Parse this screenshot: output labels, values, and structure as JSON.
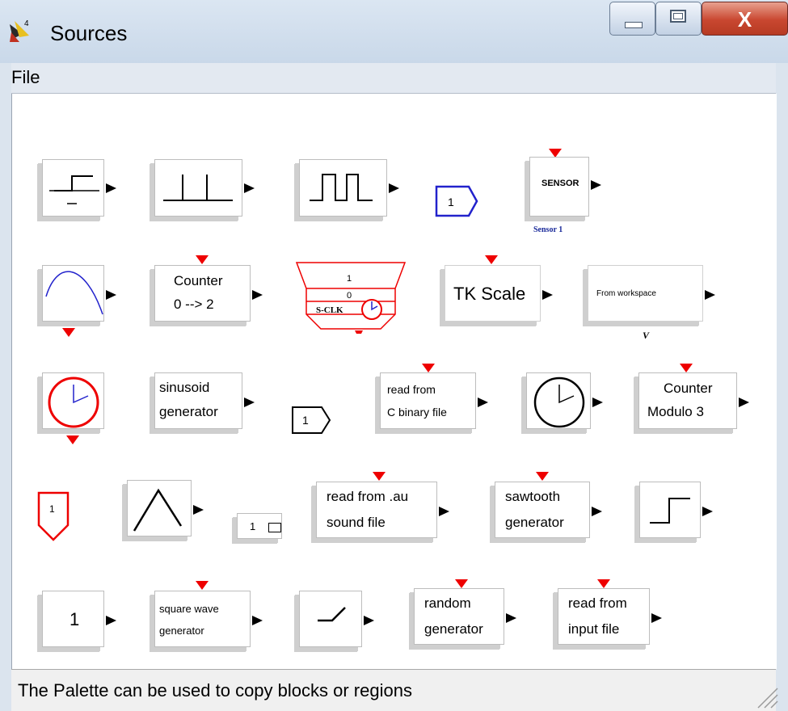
{
  "window": {
    "title": "Sources"
  },
  "menu": {
    "file": "File"
  },
  "blocks": {
    "sensor": {
      "label": "SENSOR",
      "caption": "Sensor 1"
    },
    "counter02": {
      "line1": "Counter",
      "line2": "0 --> 2"
    },
    "sclk": {
      "line1": "1",
      "line2": "0",
      "line3": "S-CLK"
    },
    "tkscale": {
      "label": "TK Scale"
    },
    "fromws": {
      "label": "From workspace",
      "caption": "V"
    },
    "sinusoid": {
      "line1": "sinusoid",
      "line2": "generator"
    },
    "readc": {
      "line1": "read from",
      "line2": "C binary file"
    },
    "countermod": {
      "line1": "Counter",
      "line2": "Modulo 3"
    },
    "readau": {
      "line1": "read from .au",
      "line2": "sound file"
    },
    "sawtooth": {
      "line1": "sawtooth",
      "line2": "generator"
    },
    "constone": {
      "label": "1"
    },
    "square": {
      "line1": "square wave",
      "line2": "generator"
    },
    "random": {
      "line1": "random",
      "line2": "generator"
    },
    "readinput": {
      "line1": "read from",
      "line2": "input file"
    },
    "inport_blue": {
      "label": "1"
    },
    "inport_black": {
      "label": "1"
    },
    "inport_red": {
      "label": "1"
    },
    "small_const": {
      "label": "1"
    }
  },
  "status": {
    "text": "The Palette can be used to copy blocks or regions"
  }
}
